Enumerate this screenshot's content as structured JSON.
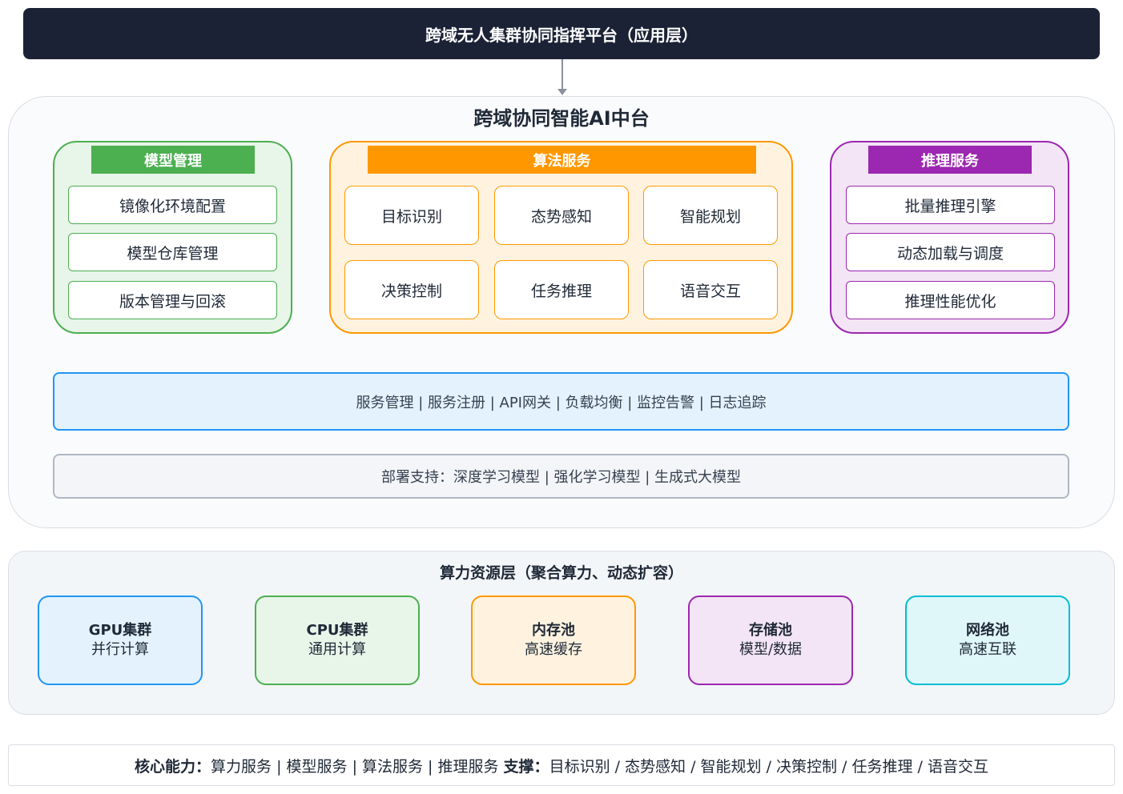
{
  "app_layer": {
    "title": "跨域无人集群协同指挥平台（应用层）"
  },
  "ai_platform": {
    "title": "跨域协同智能AI中台",
    "model_management": {
      "header": "模型管理",
      "items": [
        "镜像化环境配置",
        "模型仓库管理",
        "版本管理与回滚"
      ]
    },
    "algorithm_services": {
      "header": "算法服务",
      "items": [
        "目标识别",
        "态势感知",
        "智能规划",
        "决策控制",
        "任务推理",
        "语音交互"
      ]
    },
    "inference_services": {
      "header": "推理服务",
      "items": [
        "批量推理引擎",
        "动态加载与调度",
        "推理性能优化"
      ]
    },
    "service_bar": "服务管理 | 服务注册 | API网关 | 负载均衡 | 监控告警 | 日志追踪",
    "deploy_bar": "部署支持：深度学习模型 | 强化学习模型 | 生成式大模型"
  },
  "compute_layer": {
    "title": "算力资源层（聚合算力、动态扩容）",
    "resources": [
      {
        "name": "GPU集群",
        "desc": "并行计算"
      },
      {
        "name": "CPU集群",
        "desc": "通用计算"
      },
      {
        "name": "内存池",
        "desc": "高速缓存"
      },
      {
        "name": "存储池",
        "desc": "模型/数据"
      },
      {
        "name": "网络池",
        "desc": "高速互联"
      }
    ]
  },
  "summary": {
    "core_label": "核心能力：",
    "core_text": "算力服务 | 模型服务 | 算法服务 | 推理服务",
    "support_label": "支撑：",
    "support_text": "目标识别 / 态势感知 / 智能规划 / 决策控制 / 任务推理 / 语音交互"
  },
  "colors": {
    "app_layer_bg": "#1b2235",
    "model_accent": "#4caf50",
    "algorithm_accent": "#ff9800",
    "inference_accent": "#9c27b0",
    "service_accent": "#2196f3",
    "network_accent": "#00bcd4"
  }
}
